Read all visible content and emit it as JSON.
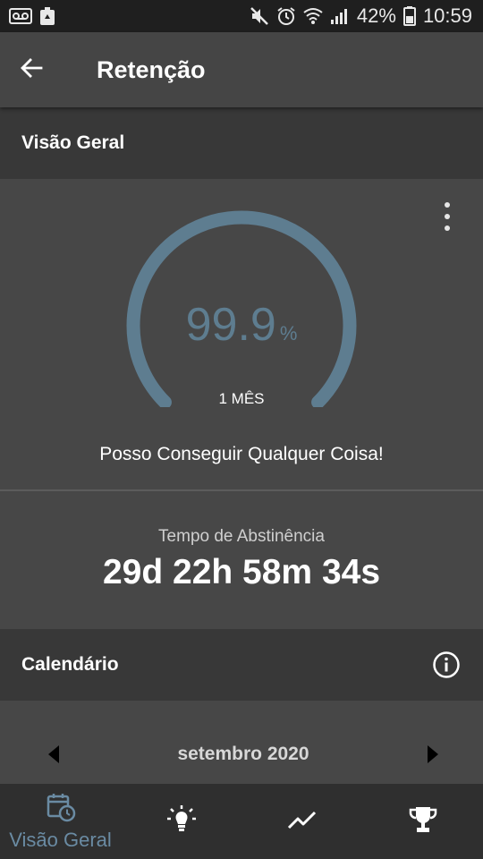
{
  "status_bar": {
    "battery_percent": "42%",
    "time": "10:59",
    "left_icons": [
      "voicemail-icon",
      "recycle-icon"
    ],
    "right_icons": [
      "mute-icon",
      "alarm-icon",
      "wifi-icon",
      "signal-icon",
      "battery-icon"
    ]
  },
  "app_bar": {
    "title": "Retenção",
    "back_icon": "arrow-left-icon"
  },
  "overview": {
    "header": "Visão Geral",
    "menu_icon": "more-vert-icon",
    "gauge": {
      "value": "99.9",
      "unit": "%",
      "label": "1 MÊS",
      "fill_fraction": 1.0,
      "arc_color": "#5e7d90"
    },
    "motto": "Posso Conseguir Qualquer Coisa!",
    "abstinence_label": "Tempo de Abstinência",
    "abstinence_value": "29d 22h 58m 34s"
  },
  "calendar": {
    "header": "Calendário",
    "info_icon": "info-icon",
    "month": "setembro 2020",
    "prev_icon": "triangle-left-icon",
    "next_icon": "triangle-right-icon"
  },
  "bottom_nav": {
    "items": [
      {
        "label": "Visão Geral",
        "icon": "calendar-clock-icon",
        "active": true
      },
      {
        "label": "",
        "icon": "lightbulb-icon",
        "active": false
      },
      {
        "label": "",
        "icon": "trending-up-icon",
        "active": false
      },
      {
        "label": "",
        "icon": "trophy-icon",
        "active": false
      }
    ],
    "active_color": "#6a8ba3",
    "inactive_color": "#ffffff"
  }
}
